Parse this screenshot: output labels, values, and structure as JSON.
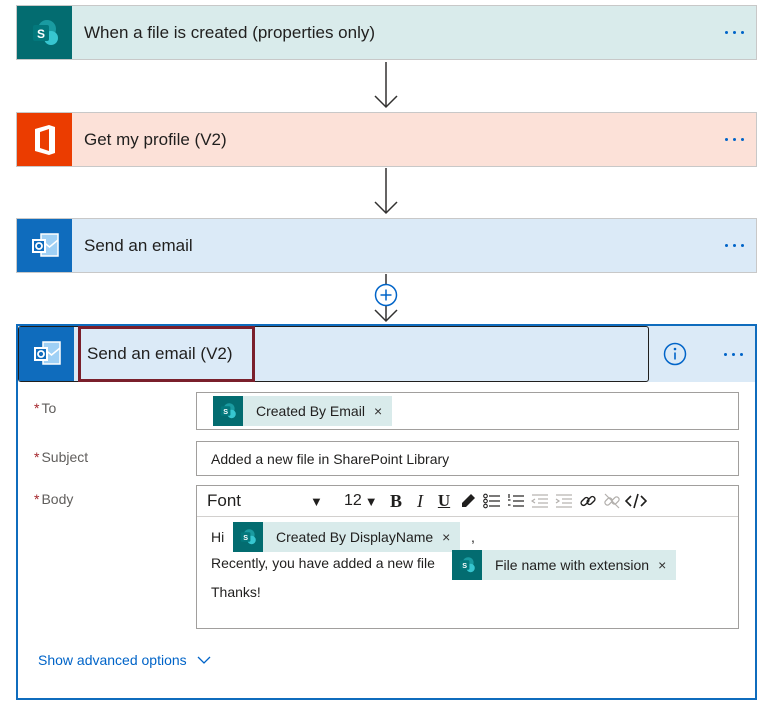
{
  "steps": [
    {
      "title": "When a file is created (properties only)",
      "icon": "sharepoint-icon",
      "color": "#036c70"
    },
    {
      "title": "Get my profile (V2)",
      "icon": "office-icon",
      "color": "#eb3c00"
    },
    {
      "title": "Send an email",
      "icon": "outlook-icon",
      "color": "#0f6cbd"
    }
  ],
  "card": {
    "title": "Send an email (V2)",
    "icon": "outlook-icon",
    "fields": {
      "to_label": "To",
      "subject_label": "Subject",
      "body_label": "Body",
      "required_mark": "*"
    },
    "to_token": {
      "label": "Created By Email",
      "remove": "×"
    },
    "subject_value": "Added a new file in SharePoint Library",
    "toolbar": {
      "font": "Font",
      "size": "12",
      "bold": "B",
      "italic": "I",
      "underline": "U"
    },
    "body": {
      "greeting": "Hi",
      "token1": {
        "label": "Created By DisplayName",
        "remove": "×"
      },
      "comma": ",",
      "line2": "Recently, you have added a new file",
      "token2": {
        "label": "File name with extension",
        "remove": "×"
      },
      "line3": "Thanks!"
    },
    "advanced_label": "Show advanced options"
  }
}
